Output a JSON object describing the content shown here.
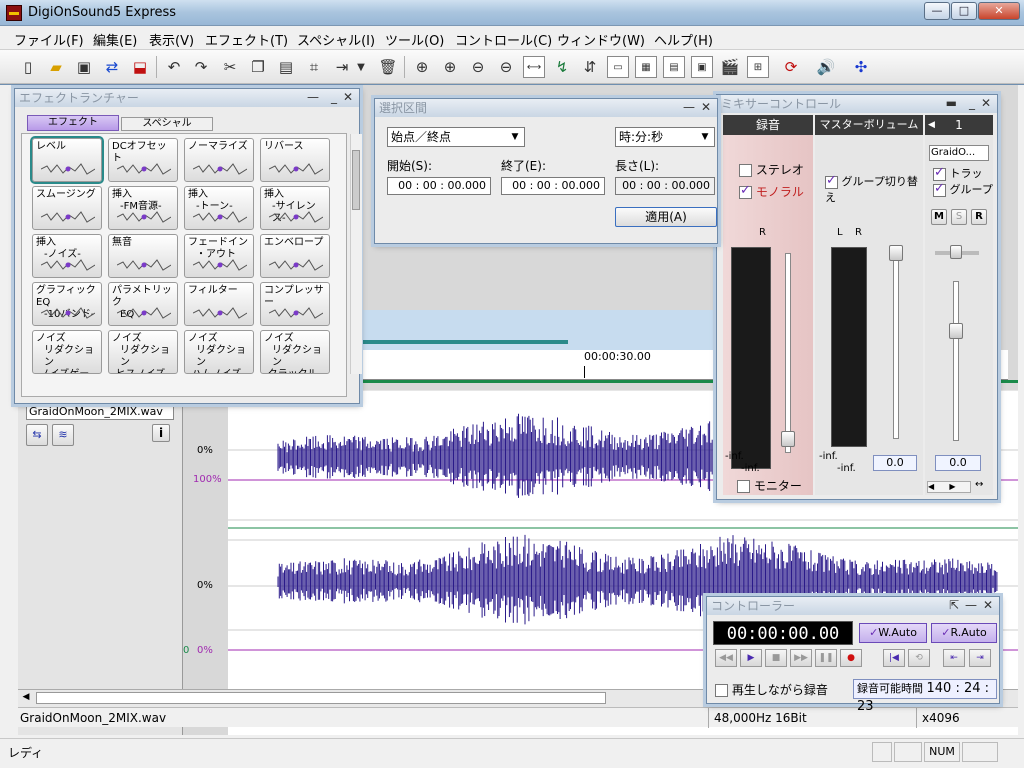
{
  "app": {
    "title": "DigiOnSound5 Express"
  },
  "menu": [
    "ファイル(F)",
    "編集(E)",
    "表示(V)",
    "エフェクト(T)",
    "スペシャル(I)",
    "ツール(O)",
    "コントロール(C)",
    "ウィンドウ(W)",
    "ヘルプ(H)"
  ],
  "toolbar_icons": [
    "new-icon",
    "open-icon",
    "save-icon",
    "export-icon",
    "import-icon",
    "undo-icon",
    "redo-icon",
    "cut-icon",
    "copy-icon",
    "paste-icon",
    "crop-icon",
    "insert-icon",
    "dropdown-icon",
    "delete-icon",
    "zoom-in-icon",
    "zoom-horizontal-icon",
    "zoom-out-icon",
    "zoom-fit-icon",
    "fit-window-icon",
    "select-icon",
    "mix-icon",
    "track-icon",
    "view1-icon",
    "view2-icon",
    "view3-icon",
    "mark-icon",
    "clapper-icon",
    "split-icon",
    "sync-icon",
    "volume-icon",
    "network-icon"
  ],
  "effect_launcher": {
    "title": "エフェクトランチャー",
    "tabs": [
      "エフェクト",
      "スペシャル"
    ],
    "items": [
      {
        "l1": "レベル",
        "l2": ""
      },
      {
        "l1": "DCオフセット",
        "l2": ""
      },
      {
        "l1": "ノーマライズ",
        "l2": ""
      },
      {
        "l1": "リバース",
        "l2": ""
      },
      {
        "l1": "スムージング",
        "l2": ""
      },
      {
        "l1": "挿入",
        "l2": "-FM音源-"
      },
      {
        "l1": "挿入",
        "l2": "-トーン-"
      },
      {
        "l1": "挿入",
        "l2": "-サイレンス-"
      },
      {
        "l1": "挿入",
        "l2": "-ノイズ-"
      },
      {
        "l1": "無音",
        "l2": ""
      },
      {
        "l1": "フェードイン",
        "l2": "・アウト"
      },
      {
        "l1": "エンベロープ",
        "l2": ""
      },
      {
        "l1": "グラフィックEQ",
        "l2": "-10バンド-"
      },
      {
        "l1": "パラメトリック",
        "l2": "EQ"
      },
      {
        "l1": "フィルター",
        "l2": ""
      },
      {
        "l1": "コンプレッサー",
        "l2": ""
      },
      {
        "l1": "ノイズ",
        "l2": "リダクション",
        "l3": "-ノイズゲート-"
      },
      {
        "l1": "ノイズ",
        "l2": "リダクション",
        "l3": "-ヒスノイズ-"
      },
      {
        "l1": "ノイズ",
        "l2": "リダクション",
        "l3": "-ハムノイズ-"
      },
      {
        "l1": "ノイズ",
        "l2": "リダクション",
        "l3": "-クラックルノイズ-"
      }
    ]
  },
  "selection": {
    "title": "選択区間",
    "mode": "始点／終点",
    "unit": "時:分:秒",
    "start_label": "開始(S):",
    "end_label": "終了(E):",
    "length_label": "長さ(L):",
    "start": "00 : 00 : 00.000",
    "end": "00 : 00 : 00.000",
    "length": "00 : 00 : 00.000",
    "apply": "適用(A)"
  },
  "mixer": {
    "title": "ミキサーコントロール",
    "rec_header": "録音",
    "master_header": "マスターボリューム",
    "track_number": "1",
    "stereo": "ステレオ",
    "mono": "モノラル",
    "group_switch": "グループ切り替え",
    "track_name": "GraidO...",
    "track_chk": "トラック",
    "group_chk": "グループ",
    "m": "M",
    "s": "S",
    "r": "R",
    "meter_R": "R",
    "meter_L": "L",
    "meter_R2": "R",
    "inf1": "-inf.",
    "inf2": "-inf.",
    "inf3": "-inf.",
    "inf4": "-inf.",
    "monitor": "モニター",
    "master_val": "0.0",
    "track_val": "0.0"
  },
  "track": {
    "filename": "GraidOnMoon_2MIX.wav",
    "time_marker": "00:00:30.00",
    "labels": {
      "a": "0%",
      "b": "100%",
      "c": "0%",
      "d": "0%",
      "e": "0"
    }
  },
  "controller": {
    "title": "コントローラー",
    "time": "00:00:00.00",
    "wauto": "W.Auto",
    "rauto": "R.Auto",
    "rec_while_play": "再生しながら録音",
    "rec_time_label": "録音可能時間",
    "rec_time": "140 : 24 : 23"
  },
  "info_bar": {
    "file": "GraidOnMoon_2MIX.wav",
    "format": "48,000Hz 16Bit",
    "zoom": "x4096"
  },
  "status": {
    "text": "レディ",
    "num": "NUM"
  },
  "colors": {
    "wave": "#2a1a8a",
    "accent": "#7b3bc8",
    "meter": "#1a1a1a"
  }
}
